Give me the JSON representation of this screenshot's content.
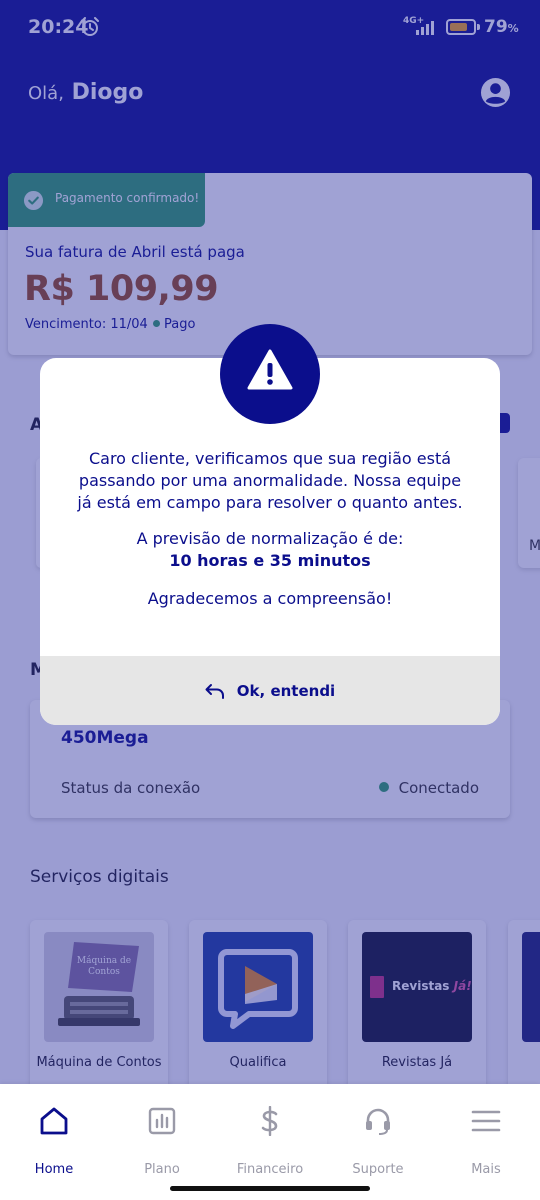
{
  "status_bar": {
    "time": "20:24",
    "network": "4G+",
    "battery_percent": "79",
    "battery_sign": "%",
    "battery_level": 0.79
  },
  "header": {
    "greeting_prefix": "Olá,",
    "user_name": "Diogo"
  },
  "invoice": {
    "toast": "Pagamento confirmado!",
    "title": "Sua fatura de Abril está paga",
    "amount": "R$ 109,99",
    "due": "Vencimento: 11/04",
    "status": "Pago"
  },
  "background": {
    "section_a_letter": "A",
    "section_m_letter": "M",
    "peek_right_letter": "M",
    "plan_speed": "450Mega",
    "connection_label": "Status da conexão",
    "connection_value": "Conectado",
    "services_title": "Serviços digitais",
    "services": [
      {
        "name": "Máquina de Contos",
        "thumb_text": "Máquina de Contos"
      },
      {
        "name": "Qualifica"
      },
      {
        "name": "Revistas Já",
        "thumb_text": "Revistas",
        "thumb_accent": "Já!"
      }
    ]
  },
  "modal": {
    "message": "Caro cliente, verificamos que sua região está passando por uma anormalidade. Nossa equipe já está em campo para resolver o quanto antes.",
    "forecast_label": "A previsão de normalização é de:",
    "forecast_value": "10 horas e 35 minutos",
    "thanks": "Agradecemos a compreensão!",
    "ok_label": "Ok, entendi"
  },
  "bottom_nav": {
    "items": [
      {
        "label": "Home",
        "icon": "home-icon",
        "active": true
      },
      {
        "label": "Plano",
        "icon": "chart-icon"
      },
      {
        "label": "Financeiro",
        "icon": "dollar-icon"
      },
      {
        "label": "Suporte",
        "icon": "headset-icon"
      },
      {
        "label": "Mais",
        "icon": "menu-icon"
      }
    ]
  },
  "colors": {
    "brand": "#0b0e8c",
    "success": "#2f9e67",
    "amount": "#9a4b1a"
  }
}
